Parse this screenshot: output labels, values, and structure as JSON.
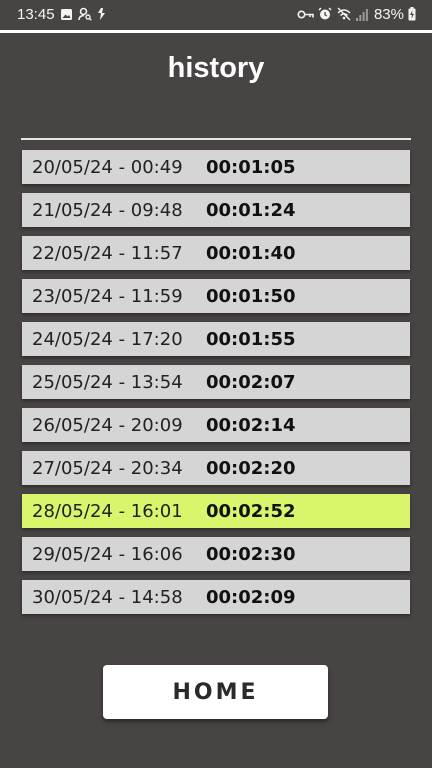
{
  "status_bar": {
    "time": "13:45",
    "battery": "83%",
    "left_icons": [
      "image-icon",
      "person-search-icon",
      "signal-arrow-icon"
    ],
    "right_icons": [
      "key-icon",
      "alarm-icon",
      "no-signal-icon",
      "cell-signal-icon",
      "battery-charging-icon"
    ]
  },
  "header": {
    "title": "history"
  },
  "history": {
    "rows": [
      {
        "date": "20/05/24 - 00:49",
        "duration": "00:01:05",
        "highlighted": false
      },
      {
        "date": "21/05/24 - 09:48",
        "duration": "00:01:24",
        "highlighted": false
      },
      {
        "date": "22/05/24 - 11:57",
        "duration": "00:01:40",
        "highlighted": false
      },
      {
        "date": "23/05/24 - 11:59",
        "duration": "00:01:50",
        "highlighted": false
      },
      {
        "date": "24/05/24 - 17:20",
        "duration": "00:01:55",
        "highlighted": false
      },
      {
        "date": "25/05/24 - 13:54",
        "duration": "00:02:07",
        "highlighted": false
      },
      {
        "date": "26/05/24 - 20:09",
        "duration": "00:02:14",
        "highlighted": false
      },
      {
        "date": "27/05/24 - 20:34",
        "duration": "00:02:20",
        "highlighted": false
      },
      {
        "date": "28/05/24 - 16:01",
        "duration": "00:02:52",
        "highlighted": true
      },
      {
        "date": "29/05/24 - 16:06",
        "duration": "00:02:30",
        "highlighted": false
      },
      {
        "date": "30/05/24 - 14:58",
        "duration": "00:02:09",
        "highlighted": false
      }
    ]
  },
  "footer": {
    "home_label": "HOME"
  },
  "colors": {
    "background": "#474443",
    "row": "#d5d5d5",
    "highlight": "#d8f56c",
    "button": "#ffffff"
  }
}
